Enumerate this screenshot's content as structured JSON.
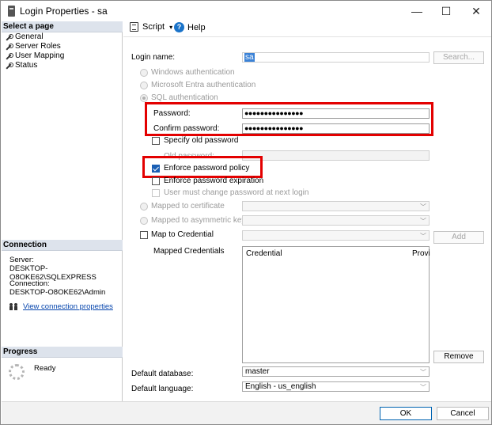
{
  "window": {
    "title": "Login Properties - sa",
    "minimize_glyph": "—",
    "maximize_glyph": "☐",
    "close_glyph": "✕"
  },
  "left": {
    "select_page_header": "Select a page",
    "pages": [
      "General",
      "Server Roles",
      "User Mapping",
      "Status"
    ],
    "connection_header": "Connection",
    "server_label": "Server:",
    "server_value": "DESKTOP-O8OKE62\\SQLEXPRESS",
    "connection_label": "Connection:",
    "connection_value": "DESKTOP-O8OKE62\\Admin",
    "view_connection_link": "View connection properties",
    "progress_header": "Progress",
    "progress_status": "Ready"
  },
  "toolbar": {
    "script_label": "Script",
    "help_label": "Help",
    "dropdown_caret": "▾"
  },
  "form": {
    "login_name_label": "Login name:",
    "login_name_value": "sa",
    "search_button": "Search...",
    "windows_auth": "Windows authentication",
    "entra_auth": "Microsoft Entra authentication",
    "sql_auth": "SQL authentication",
    "password_label": "Password:",
    "password_value": "●●●●●●●●●●●●●●●",
    "confirm_password_label": "Confirm password:",
    "confirm_password_value": "●●●●●●●●●●●●●●●",
    "specify_old_password": "Specify old password",
    "old_password_label": "Old password:",
    "enforce_policy": "Enforce password policy",
    "enforce_expiration": "Enforce password expiration",
    "must_change": "User must change password at next login",
    "mapped_to_certificate": "Mapped to certificate",
    "mapped_to_asym_key": "Mapped to asymmetric key",
    "map_to_credential": "Map to Credential",
    "add_button": "Add",
    "mapped_credentials_label": "Mapped Credentials",
    "cred_col_credential": "Credential",
    "cred_col_provider": "Provi",
    "remove_button": "Remove",
    "default_database_label": "Default database:",
    "default_database_value": "master",
    "default_language_label": "Default language:",
    "default_language_value": "English - us_english"
  },
  "footer": {
    "ok_button": "OK",
    "cancel_button": "Cancel"
  },
  "colors": {
    "highlight_box": "#e30000",
    "checkbox_checked": "#1a5fb4",
    "selection": "#3b82d6",
    "section_header_bg": "#dde3ec"
  }
}
